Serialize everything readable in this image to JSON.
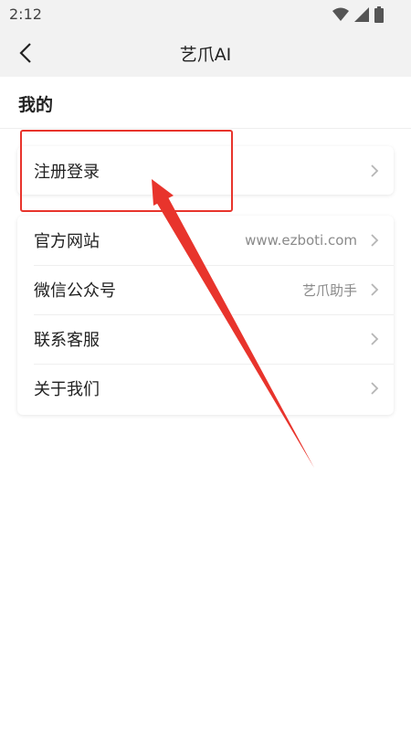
{
  "status_bar": {
    "time": "2:12",
    "icons": [
      "wifi-icon",
      "signal-icon",
      "battery-icon"
    ]
  },
  "nav": {
    "title": "艺爪AI",
    "back_icon": "back-arrow-icon"
  },
  "section": {
    "title": "我的"
  },
  "login_row": {
    "label": "注册登录"
  },
  "menu_items": [
    {
      "label": "官方网站",
      "value": "www.ezboti.com"
    },
    {
      "label": "微信公众号",
      "value": "艺爪助手"
    },
    {
      "label": "联系客服",
      "value": ""
    },
    {
      "label": "关于我们",
      "value": ""
    }
  ],
  "colors": {
    "bar_bg": "#f2f2f2",
    "annotation_red": "#e8342c",
    "value_gray": "#8a8a8a"
  }
}
